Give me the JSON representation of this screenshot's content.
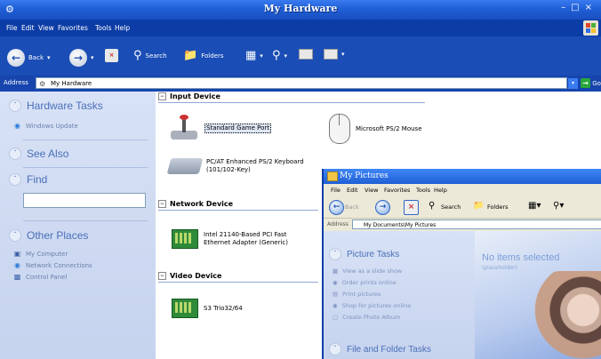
{
  "window": {
    "title": "My Hardware",
    "menu": [
      "File",
      "Edit",
      "View",
      "Favorites",
      "Tools",
      "Help"
    ]
  },
  "toolbar": {
    "back": "Back",
    "search": "Search",
    "folders": "Folders"
  },
  "address": {
    "label": "Address",
    "value": "My Hardware",
    "go": "Go"
  },
  "sidebar": {
    "hardware_tasks": "Hardware Tasks",
    "windows_update": "Windows Update",
    "see_also": "See Also",
    "find": "Find",
    "other_places": "Other Places",
    "other_items": [
      "My Computer",
      "Network Connections",
      "Control Panel"
    ]
  },
  "groups": {
    "input": "Input Device",
    "network": "Network Device",
    "video": "Video Device"
  },
  "devices": {
    "game_port": "Standard Game Port",
    "mouse": "Microsoft PS/2 Mouse",
    "keyboard_line1": "PC/AT Enhanced PS/2 Keyboard",
    "keyboard_line2": "(101/102-Key)",
    "net_line1": "Intel 21140-Based PCI Fast",
    "net_line2": "Ethernet Adapter (Generic)",
    "video": "S3 Trio32/64"
  },
  "pictures_window": {
    "title": "My Pictures",
    "menu": [
      "File",
      "Edit",
      "View",
      "Favorites",
      "Tools",
      "Help"
    ],
    "back": "Back",
    "search": "Search",
    "folders": "Folders",
    "address_label": "Address",
    "address_value": "My Documents\\My Pictures",
    "picture_tasks": "Picture Tasks",
    "tasks": [
      "View as a slide show",
      "Order prints online",
      "Print pictures",
      "Shop for pictures online",
      "Create Photo Album"
    ],
    "file_folder_tasks": "File and Folder Tasks",
    "no_items": "No items selected",
    "placeholder": "(placeholder)"
  },
  "colors": {
    "title_blue": "#1f5fd6",
    "menubar_blue": "#0c3ca6",
    "sidebar_bg": "#d8e2f6",
    "sidebar_heading": "#4a6fb8"
  }
}
